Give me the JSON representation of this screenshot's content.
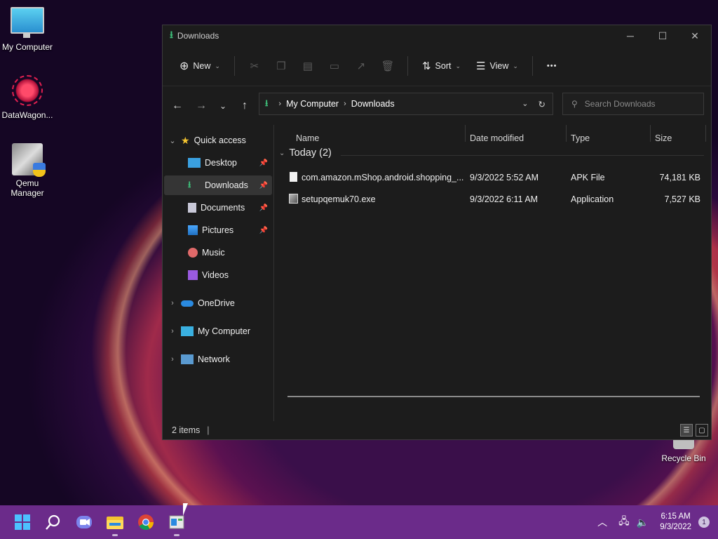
{
  "desktop": {
    "icons": [
      {
        "label": "My Computer",
        "icon": "monitor-icon"
      },
      {
        "label": "DataWagon...",
        "icon": "datawagon-icon"
      },
      {
        "label": "Qemu Manager",
        "icon": "qemu-icon"
      },
      {
        "label": "Recycle Bin",
        "icon": "recycle-bin-icon"
      }
    ]
  },
  "window": {
    "title": "Downloads",
    "controls": {
      "minimize": "─",
      "maximize": "☐",
      "close": "✕"
    }
  },
  "toolbar": {
    "new_label": "New",
    "sort_label": "Sort",
    "view_label": "View",
    "more_label": "•••"
  },
  "address": {
    "crumbs": [
      "My Computer",
      "Downloads"
    ],
    "search_placeholder": "Search Downloads"
  },
  "nav": {
    "quick_access": "Quick access",
    "items": [
      {
        "label": "Desktop",
        "pinned": true
      },
      {
        "label": "Downloads",
        "pinned": true,
        "selected": true
      },
      {
        "label": "Documents",
        "pinned": true
      },
      {
        "label": "Pictures",
        "pinned": true
      },
      {
        "label": "Music",
        "pinned": false
      },
      {
        "label": "Videos",
        "pinned": false
      }
    ],
    "roots": [
      "OneDrive",
      "My Computer",
      "Network"
    ]
  },
  "files": {
    "columns": [
      "Name",
      "Date modified",
      "Type",
      "Size"
    ],
    "group": "Today (2)",
    "rows": [
      {
        "name": "com.amazon.mShop.android.shopping_...",
        "date": "9/3/2022 5:52 AM",
        "type": "APK File",
        "size": "74,181 KB"
      },
      {
        "name": "setupqemuk70.exe",
        "date": "9/3/2022 6:11 AM",
        "type": "Application",
        "size": "7,527 KB"
      }
    ]
  },
  "status": {
    "item_count": "2 items"
  },
  "taskbar": {
    "time": "6:15 AM",
    "date": "9/3/2022",
    "notification_count": "1"
  },
  "colors": {
    "accent_green": "#3ec07a",
    "taskbar": "#6b2b8a",
    "window_bg": "#1c1c1c"
  }
}
